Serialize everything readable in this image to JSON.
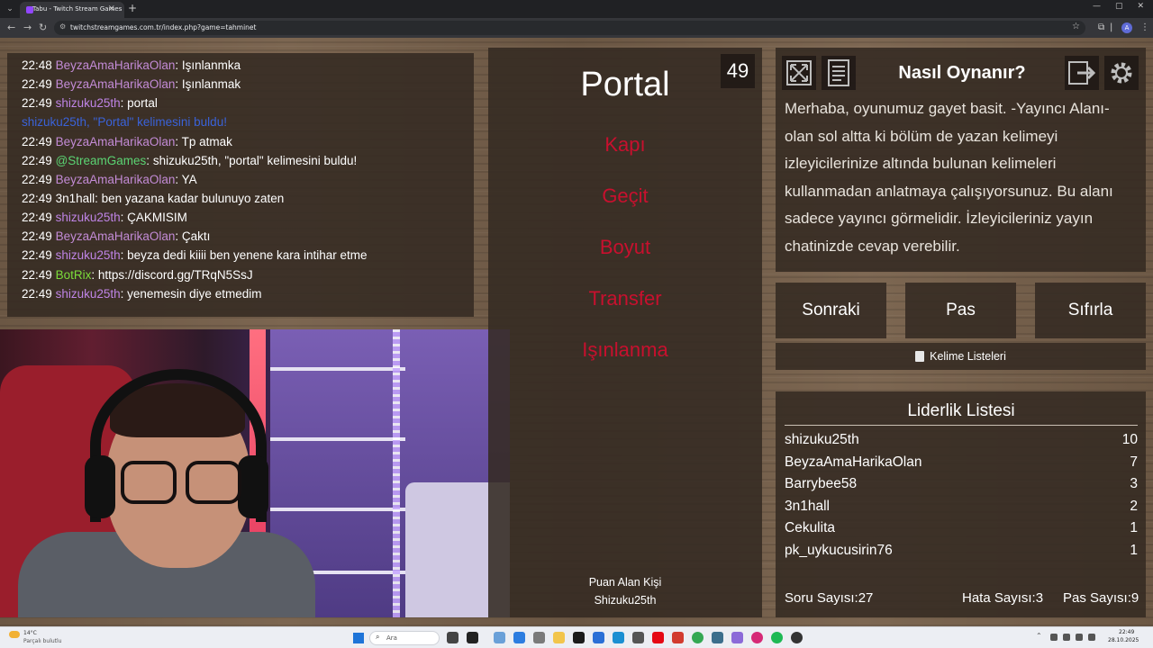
{
  "browser": {
    "tab_title": "Tabu - Twitch Stream Games",
    "url": "twitchstreamgames.com.tr/index.php?game=tahminet",
    "profile_initial": "A"
  },
  "chat": {
    "lines": [
      {
        "time": "22:48",
        "user": "BeyzaAmaHarikaOlan",
        "sep": ": ",
        "text": "Işınlanmka",
        "user_color": "purple"
      },
      {
        "time": "22:49",
        "user": "BeyzaAmaHarikaOlan",
        "sep": ": ",
        "text": "Işınlanmak",
        "user_color": "purple"
      },
      {
        "time": "22:49",
        "user": "shizuku25th",
        "sep": ": ",
        "text": "portal",
        "user_color": "pink"
      },
      {
        "time": "",
        "user": "",
        "sep": "",
        "text": "shizuku25th, \"Portal\" kelimesini buldu!",
        "user_color": "blue"
      },
      {
        "time": "22:49",
        "user": "BeyzaAmaHarikaOlan",
        "sep": ": ",
        "text": "Tp atmak",
        "user_color": "purple"
      },
      {
        "time": "22:49",
        "user": "@StreamGames",
        "sep": ": ",
        "text": "shizuku25th, \"portal\" kelimesini buldu!",
        "user_color": "green"
      },
      {
        "time": "22:49",
        "user": "BeyzaAmaHarikaOlan",
        "sep": ": ",
        "text": "YA",
        "user_color": "purple"
      },
      {
        "time": "22:49",
        "user": "3n1hall",
        "sep": ": ",
        "text": "ben yazana kadar bulunuyo zaten",
        "user_color": "white"
      },
      {
        "time": "22:49",
        "user": "shizuku25th",
        "sep": ": ",
        "text": "ÇAKMISIM",
        "user_color": "pink"
      },
      {
        "time": "22:49",
        "user": "BeyzaAmaHarikaOlan",
        "sep": ": ",
        "text": "Çaktı",
        "user_color": "purple"
      },
      {
        "time": "22:49",
        "user": "shizuku25th",
        "sep": ": ",
        "text": "beyza dedi kiiii ben yenene kara intihar etme",
        "user_color": "pink"
      },
      {
        "time": "22:49",
        "user": "BotRix",
        "sep": ": ",
        "text": "https://discord.gg/TRqN5SsJ",
        "user_color": "lime"
      },
      {
        "time": "22:49",
        "user": "shizuku25th",
        "sep": ": ",
        "text": "yenemesin diye etmedim",
        "user_color": "pink"
      }
    ]
  },
  "game": {
    "timer": "49",
    "word": "Portal",
    "forbidden_words": [
      "Kapı",
      "Geçit",
      "Boyut",
      "Transfer",
      "Işınlanma"
    ],
    "scorer_label": "Puan Alan Kişi",
    "scorer_name": "Shizuku25th"
  },
  "howto": {
    "title": "Nasıl Oynanır?",
    "text": "Merhaba, oyunumuz gayet basit. -Yayıncı Alanı- olan sol altta ki bölüm de yazan kelimeyi izleyicilerinize altında bulunan kelimeleri kullanmadan anlatmaya çalışıyorsunuz. Bu alanı sadece yayıncı görmelidir. İzleyicileriniz yayın chatinizde cevap verebilir."
  },
  "actions": {
    "next": "Sonraki",
    "pass": "Pas",
    "reset": "Sıfırla",
    "word_lists": "Kelime Listeleri"
  },
  "leaderboard": {
    "title": "Liderlik Listesi",
    "rows": [
      {
        "name": "shizuku25th",
        "score": "10"
      },
      {
        "name": "BeyzaAmaHarikaOlan",
        "score": "7"
      },
      {
        "name": "Barrybee58",
        "score": "3"
      },
      {
        "name": "3n1hall",
        "score": "2"
      },
      {
        "name": "Cekulita",
        "score": "1"
      },
      {
        "name": "pk_uykucusirin76",
        "score": "1"
      }
    ]
  },
  "stats": {
    "questions_label": "Soru Sayısı:",
    "questions": "27",
    "errors_label": "Hata Sayısı:",
    "errors": "3",
    "passes_label": "Pas Sayısı:",
    "passes": "9"
  },
  "taskbar": {
    "temperature": "14°C",
    "weather": "Parçalı bulutlu",
    "search_placeholder": "Ara",
    "time": "22:49",
    "date": "28.10.2025"
  },
  "colors": {
    "forbidden": "#c8102e",
    "chat_purple": "#c38bd6",
    "chat_green": "#5bd473",
    "chat_blue": "#3a62d8",
    "panel": "#342a22"
  }
}
